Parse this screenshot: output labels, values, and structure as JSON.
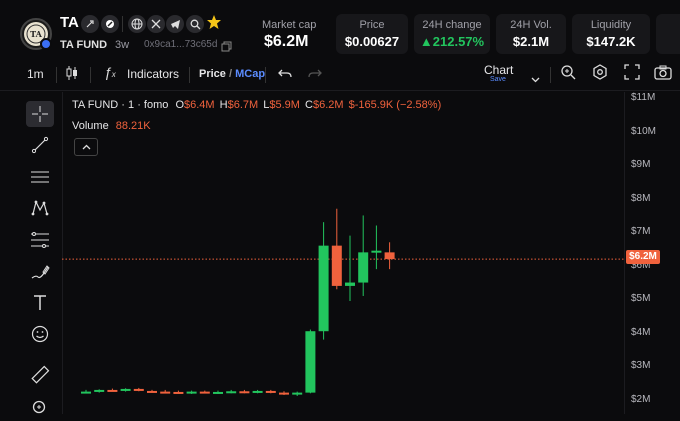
{
  "header": {
    "ticker": "TA",
    "token_name": "TA FUND",
    "age": "3w",
    "address": "0x9ca1...73c65d",
    "icons": [
      "rocket-icon",
      "pill-icon",
      "globe-icon",
      "x-icon",
      "telegram-icon",
      "search-icon",
      "star-icon"
    ],
    "market_cap_label": "Market cap",
    "market_cap_value": "$6.2M",
    "stats": [
      {
        "label": "Price",
        "value": "$0.00627",
        "color": "#ffffff"
      },
      {
        "label": "24H change",
        "value": "▲212.57%",
        "color": "#22c55e"
      },
      {
        "label": "24H Vol.",
        "value": "$2.1M",
        "color": "#ffffff"
      },
      {
        "label": "Liquidity",
        "value": "$147.2K",
        "color": "#ffffff"
      }
    ]
  },
  "toolbar": {
    "interval": "1m",
    "indicators_label": "Indicators",
    "price_label": "Price",
    "price_sep": "/",
    "mcap_label": "MCap",
    "chart_label": "Chart",
    "save_label": "Save"
  },
  "legend": {
    "title": "TA FUND · 1 · fomo",
    "o_label": "O",
    "o_value": "$6.4M",
    "h_label": "H",
    "h_value": "$6.7M",
    "l_label": "L",
    "l_value": "$5.9M",
    "c_label": "C",
    "c_value": "$6.2M",
    "change": "$-165.9K (−2.58%)",
    "volume_label": "Volume",
    "volume_value": "88.21K"
  },
  "price_tag": "$6.2M",
  "colors": {
    "up": "#22c55e",
    "down": "#f0623d",
    "accent": "#3b6ff5"
  },
  "chart_data": {
    "type": "candlestick",
    "y_unit": "market cap ($M)",
    "ylim": [
      1.75,
      11.2
    ],
    "y_ticks": [
      "$11M",
      "$10M",
      "$9M",
      "$8M",
      "$7M",
      "$6M",
      "$5M",
      "$4M",
      "$3M",
      "$2M"
    ],
    "y_tick_values": [
      11,
      10,
      9,
      8,
      7,
      6,
      5,
      4,
      3,
      2
    ],
    "current": 6.2,
    "candles": [
      {
        "o": 2.25,
        "h": 2.3,
        "l": 2.2,
        "c": 2.25
      },
      {
        "o": 2.25,
        "h": 2.32,
        "l": 2.22,
        "c": 2.3
      },
      {
        "o": 2.3,
        "h": 2.34,
        "l": 2.26,
        "c": 2.27
      },
      {
        "o": 2.27,
        "h": 2.35,
        "l": 2.25,
        "c": 2.33
      },
      {
        "o": 2.33,
        "h": 2.36,
        "l": 2.26,
        "c": 2.27
      },
      {
        "o": 2.27,
        "h": 2.3,
        "l": 2.22,
        "c": 2.25
      },
      {
        "o": 2.25,
        "h": 2.3,
        "l": 2.2,
        "c": 2.24
      },
      {
        "o": 2.24,
        "h": 2.28,
        "l": 2.2,
        "c": 2.22
      },
      {
        "o": 2.22,
        "h": 2.28,
        "l": 2.18,
        "c": 2.25
      },
      {
        "o": 2.25,
        "h": 2.28,
        "l": 2.2,
        "c": 2.23
      },
      {
        "o": 2.23,
        "h": 2.28,
        "l": 2.18,
        "c": 2.24
      },
      {
        "o": 2.24,
        "h": 2.3,
        "l": 2.2,
        "c": 2.26
      },
      {
        "o": 2.26,
        "h": 2.3,
        "l": 2.2,
        "c": 2.24
      },
      {
        "o": 2.24,
        "h": 2.3,
        "l": 2.2,
        "c": 2.27
      },
      {
        "o": 2.27,
        "h": 2.3,
        "l": 2.2,
        "c": 2.22
      },
      {
        "o": 2.22,
        "h": 2.26,
        "l": 2.15,
        "c": 2.18
      },
      {
        "o": 2.18,
        "h": 2.25,
        "l": 2.12,
        "c": 2.22
      },
      {
        "o": 2.22,
        "h": 4.1,
        "l": 2.2,
        "c": 4.05
      },
      {
        "o": 4.05,
        "h": 7.3,
        "l": 3.8,
        "c": 6.6
      },
      {
        "o": 6.6,
        "h": 7.7,
        "l": 5.3,
        "c": 5.4
      },
      {
        "o": 5.4,
        "h": 6.9,
        "l": 4.95,
        "c": 5.5
      },
      {
        "o": 5.5,
        "h": 7.5,
        "l": 5.1,
        "c": 6.4
      },
      {
        "o": 6.4,
        "h": 7.2,
        "l": 5.9,
        "c": 6.45
      },
      {
        "o": 6.4,
        "h": 6.7,
        "l": 5.9,
        "c": 6.2
      }
    ]
  }
}
